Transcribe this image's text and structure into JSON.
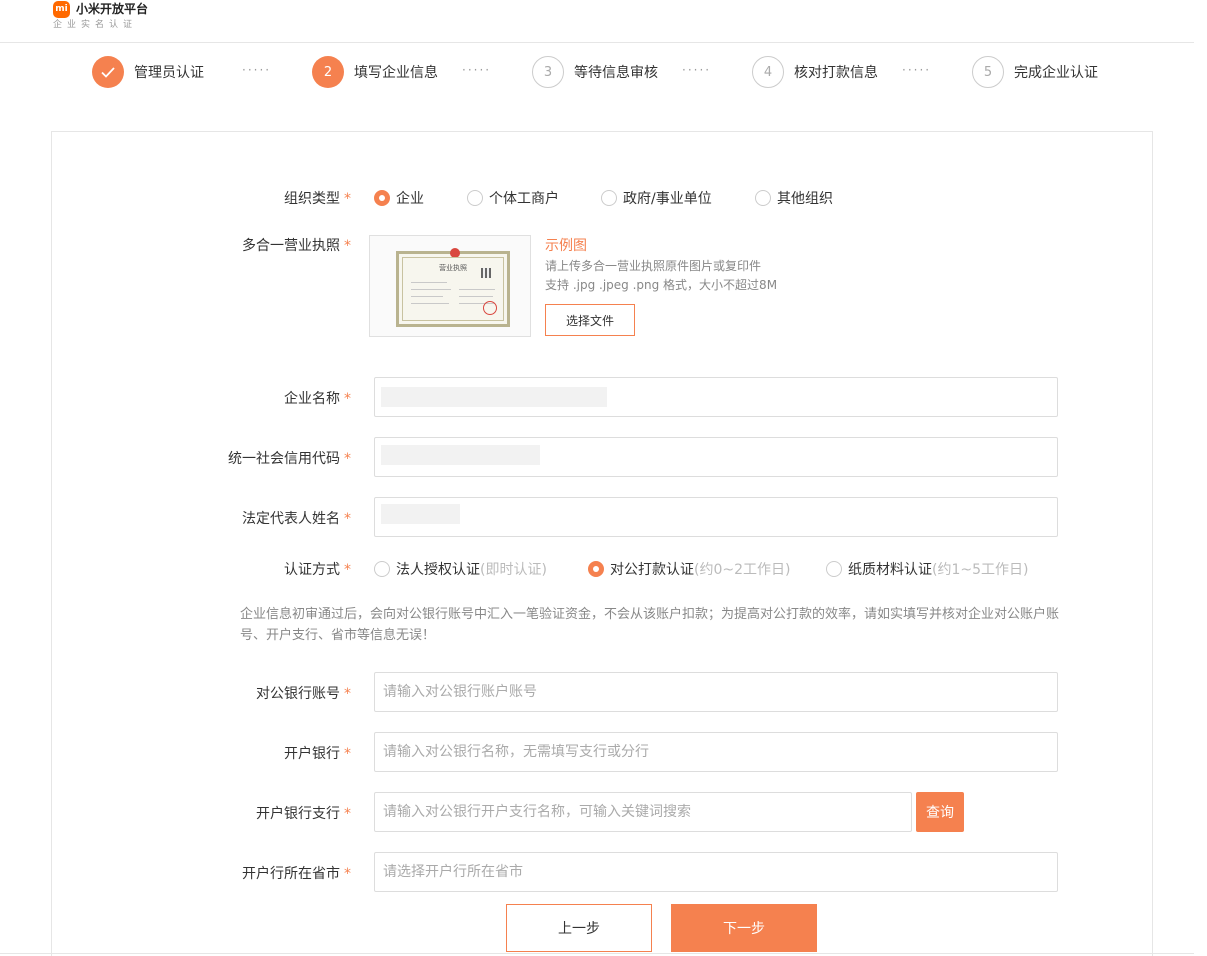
{
  "header": {
    "logo_text": "mi",
    "brand_name": "小米开放平台",
    "brand_sub": "企业实名认证"
  },
  "steps": [
    {
      "index": "1",
      "label": "管理员认证",
      "state": "done"
    },
    {
      "index": "2",
      "label": "填写企业信息",
      "state": "active"
    },
    {
      "index": "3",
      "label": "等待信息审核",
      "state": "pending"
    },
    {
      "index": "4",
      "label": "核对打款信息",
      "state": "pending"
    },
    {
      "index": "5",
      "label": "完成企业认证",
      "state": "pending"
    }
  ],
  "step_separator": "·····",
  "form": {
    "required_mark": "*",
    "org_type": {
      "label": "组织类型",
      "options": [
        "企业",
        "个体工商户",
        "政府/事业单位",
        "其他组织"
      ],
      "selected": "企业"
    },
    "license": {
      "label": "多合一营业执照",
      "sample_title": "示例图",
      "desc_line1": "请上传多合一营业执照原件图片或复印件",
      "desc_line2": "支持 .jpg .jpeg .png 格式，大小不超过8M",
      "button_label": "选择文件",
      "cert_title": "营业执照"
    },
    "company_name": {
      "label": "企业名称",
      "value": ""
    },
    "credit_code": {
      "label": "统一社会信用代码",
      "value": ""
    },
    "legal_rep": {
      "label": "法定代表人姓名",
      "value": ""
    },
    "auth_method": {
      "label": "认证方式",
      "options": [
        {
          "text": "法人授权认证",
          "hint": "(即时认证)",
          "checked": false
        },
        {
          "text": "对公打款认证",
          "hint": "(约0~2工作日)",
          "checked": true
        },
        {
          "text": "纸质材料认证",
          "hint": "(约1~5工作日)",
          "checked": false
        }
      ]
    },
    "notice": "企业信息初审通过后，会向对公银行账号中汇入一笔验证资金，不会从该账户扣款；为提高对公打款的效率，请如实填写并核对企业对公账户账号、开户支行、省市等信息无误！",
    "bank_account": {
      "label": "对公银行账号",
      "placeholder": "请输入对公银行账户账号"
    },
    "bank_name": {
      "label": "开户银行",
      "placeholder": "请输入对公银行名称，无需填写支行或分行"
    },
    "bank_branch": {
      "label": "开户银行支行",
      "placeholder": "请输入对公银行开户支行名称，可输入关键词搜索",
      "query_label": "查询"
    },
    "bank_city": {
      "label": "开户行所在省市",
      "placeholder": "请选择开户行所在省市"
    },
    "prev_label": "上一步",
    "next_label": "下一步"
  },
  "colors": {
    "accent": "#f5814f",
    "brand": "#ff6900"
  }
}
